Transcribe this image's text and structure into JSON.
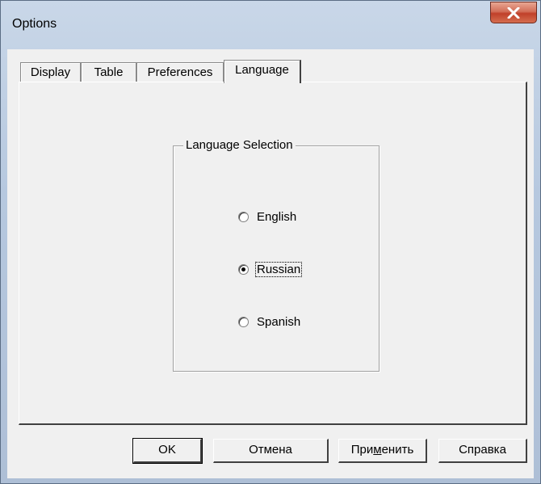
{
  "window": {
    "title": "Options"
  },
  "tabs": [
    {
      "label": "Display",
      "active": false
    },
    {
      "label": "Table",
      "active": false
    },
    {
      "label": "Preferences",
      "active": false
    },
    {
      "label": "Language",
      "active": true
    }
  ],
  "language_group": {
    "legend": "Language Selection",
    "options": [
      {
        "label": "English",
        "checked": false
      },
      {
        "label": "Russian",
        "checked": true
      },
      {
        "label": "Spanish",
        "checked": false
      }
    ]
  },
  "buttons": {
    "ok": "OK",
    "cancel": "Отмена",
    "apply_pre": "При",
    "apply_mnemonic": "м",
    "apply_post": "енить",
    "help": "Справка"
  }
}
